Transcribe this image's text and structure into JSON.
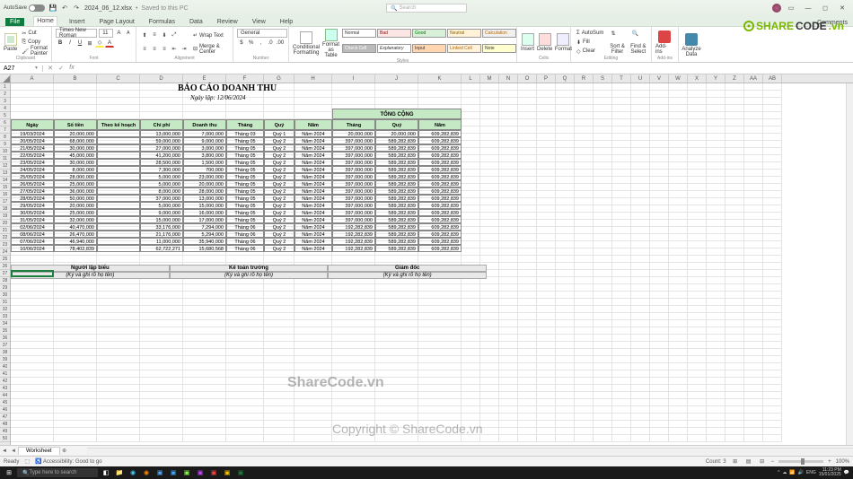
{
  "title": {
    "autosave": "AutoSave",
    "doc": "2024_06_12.xlsx",
    "saved": "Saved to this PC",
    "search_ph": "Search"
  },
  "tabs": [
    "File",
    "Home",
    "Insert",
    "Page Layout",
    "Formulas",
    "Data",
    "Review",
    "View",
    "Help"
  ],
  "tabs_right": "Comments",
  "ribbon": {
    "clipboard": {
      "paste": "Paste",
      "cut": "Cut",
      "copy": "Copy",
      "fp": "Format Painter",
      "name": "Clipboard"
    },
    "font": {
      "family": "Times New Roman",
      "size": "11",
      "name": "Font"
    },
    "align": {
      "wrap": "Wrap Text",
      "merge": "Merge & Center",
      "name": "Alignment"
    },
    "number": {
      "fmt": "General",
      "name": "Number"
    },
    "styles": {
      "cond": "Conditional Formatting",
      "fat": "Format as Table",
      "cells": [
        "Normal",
        "Bad",
        "Good",
        "Neutral",
        "Calculation",
        "Check Cell",
        "Explanatory",
        "Input",
        "Linked Cell",
        "Note"
      ],
      "name": "Styles"
    },
    "cells_g": {
      "ins": "Insert",
      "del": "Delete",
      "fmt": "Format",
      "name": "Cells"
    },
    "editing": {
      "as": "AutoSum",
      "fill": "Fill",
      "clr": "Clear",
      "sf": "Sort & Filter",
      "fs": "Find & Select",
      "name": "Editing"
    },
    "addins": {
      "ai": "Add-ins",
      "name": "Add-ins"
    },
    "analysis": {
      "ad": "Analyze Data"
    }
  },
  "fbar": {
    "name": "A27",
    "fx": "fx"
  },
  "cols": [
    "A",
    "B",
    "C",
    "D",
    "E",
    "F",
    "G",
    "H",
    "I",
    "J",
    "K",
    "L",
    "M",
    "N",
    "O",
    "P",
    "Q",
    "R",
    "S",
    "T",
    "U",
    "V",
    "W",
    "X",
    "Y",
    "Z",
    "AA",
    "AB"
  ],
  "report": {
    "title": "BÁO CÁO DOANH THU",
    "sub": "Ngày lập: 12/06/2024",
    "tong": "TỔNG CỘNG",
    "headers": [
      "Ngày",
      "Số tiền",
      "Theo kế hoạch",
      "Chi phí",
      "Doanh thu",
      "Tháng",
      "Quý",
      "Năm"
    ],
    "tot_headers": [
      "Tháng",
      "Quý",
      "Năm"
    ],
    "rows": [
      [
        "19/03/2024",
        "20,000,000",
        "",
        "13,000,000",
        "7,000,000",
        "Tháng 03",
        "Quý 1",
        "Năm 2024",
        "20,000,000",
        "20,000,000",
        "609,282,839"
      ],
      [
        "20/05/2024",
        "68,000,000",
        "",
        "59,000,000",
        "9,000,000",
        "Tháng 05",
        "Quý 2",
        "Năm 2024",
        "397,000,000",
        "589,282,839",
        "609,282,839"
      ],
      [
        "21/05/2024",
        "30,000,000",
        "",
        "27,000,000",
        "3,000,000",
        "Tháng 05",
        "Quý 2",
        "Năm 2024",
        "397,000,000",
        "589,282,839",
        "609,282,839"
      ],
      [
        "22/05/2024",
        "45,000,000",
        "",
        "41,200,000",
        "3,800,000",
        "Tháng 05",
        "Quý 2",
        "Năm 2024",
        "397,000,000",
        "589,282,839",
        "609,282,839"
      ],
      [
        "23/05/2024",
        "30,000,000",
        "",
        "28,500,000",
        "1,500,000",
        "Tháng 05",
        "Quý 2",
        "Năm 2024",
        "397,000,000",
        "589,282,839",
        "609,282,839"
      ],
      [
        "24/05/2024",
        "8,000,000",
        "",
        "7,300,000",
        "700,000",
        "Tháng 05",
        "Quý 2",
        "Năm 2024",
        "397,000,000",
        "589,282,839",
        "609,282,839"
      ],
      [
        "25/05/2024",
        "28,000,000",
        "",
        "5,000,000",
        "23,000,000",
        "Tháng 05",
        "Quý 2",
        "Năm 2024",
        "397,000,000",
        "589,282,839",
        "609,282,839"
      ],
      [
        "26/05/2024",
        "25,000,000",
        "",
        "5,000,000",
        "20,000,000",
        "Tháng 05",
        "Quý 2",
        "Năm 2024",
        "397,000,000",
        "589,282,839",
        "609,282,839"
      ],
      [
        "27/05/2024",
        "36,000,000",
        "",
        "8,000,000",
        "28,000,000",
        "Tháng 05",
        "Quý 2",
        "Năm 2024",
        "397,000,000",
        "589,282,839",
        "609,282,839"
      ],
      [
        "28/05/2024",
        "50,000,000",
        "",
        "37,000,000",
        "13,000,000",
        "Tháng 05",
        "Quý 2",
        "Năm 2024",
        "397,000,000",
        "589,282,839",
        "609,282,839"
      ],
      [
        "29/05/2024",
        "20,000,000",
        "",
        "5,000,000",
        "15,000,000",
        "Tháng 05",
        "Quý 2",
        "Năm 2024",
        "397,000,000",
        "589,282,839",
        "609,282,839"
      ],
      [
        "30/05/2024",
        "25,000,000",
        "",
        "9,000,000",
        "16,000,000",
        "Tháng 05",
        "Quý 2",
        "Năm 2024",
        "397,000,000",
        "589,282,839",
        "609,282,839"
      ],
      [
        "31/05/2024",
        "32,000,000",
        "",
        "15,000,000",
        "17,000,000",
        "Tháng 05",
        "Quý 2",
        "Năm 2024",
        "397,000,000",
        "589,282,839",
        "609,282,839"
      ],
      [
        "02/06/2024",
        "40,470,000",
        "",
        "33,176,000",
        "7,294,000",
        "Tháng 06",
        "Quý 2",
        "Năm 2024",
        "192,282,839",
        "589,282,839",
        "609,282,839"
      ],
      [
        "08/06/2024",
        "26,470,000",
        "",
        "21,176,000",
        "5,294,000",
        "Tháng 06",
        "Quý 2",
        "Năm 2024",
        "192,282,839",
        "589,282,839",
        "609,282,839"
      ],
      [
        "07/06/2024",
        "46,940,000",
        "",
        "11,000,000",
        "35,940,000",
        "Tháng 06",
        "Quý 2",
        "Năm 2024",
        "192,282,839",
        "589,282,839",
        "609,282,839"
      ],
      [
        "10/06/2024",
        "78,402,839",
        "",
        "62,722,271",
        "15,680,568",
        "Tháng 06",
        "Quý 2",
        "Năm 2024",
        "192,282,839",
        "589,282,839",
        "609,282,839"
      ]
    ],
    "sigs": [
      {
        "h": "Người lập biểu",
        "s": "(Ký và ghi rõ họ tên)"
      },
      {
        "h": "Kế toán trưởng",
        "s": "(Ký và ghi rõ họ tên)"
      },
      {
        "h": "Giám đốc",
        "s": "(Ký và ghi rõ họ tên)"
      }
    ]
  },
  "sheet": {
    "tab": "Worksheet"
  },
  "status": {
    "ready": "Ready",
    "acc": "Accessibility: Good to go",
    "count": "Count: 3",
    "zoom": "100%"
  },
  "taskbar": {
    "search": "Type here to search",
    "time": "11:23 PM",
    "date": "15/01/2025"
  },
  "wm": {
    "a": "ShareCode.vn",
    "b": "Copyright © ShareCode.vn"
  },
  "logo": {
    "a": "SHARE",
    "b": "CODE",
    "c": ".vn"
  }
}
